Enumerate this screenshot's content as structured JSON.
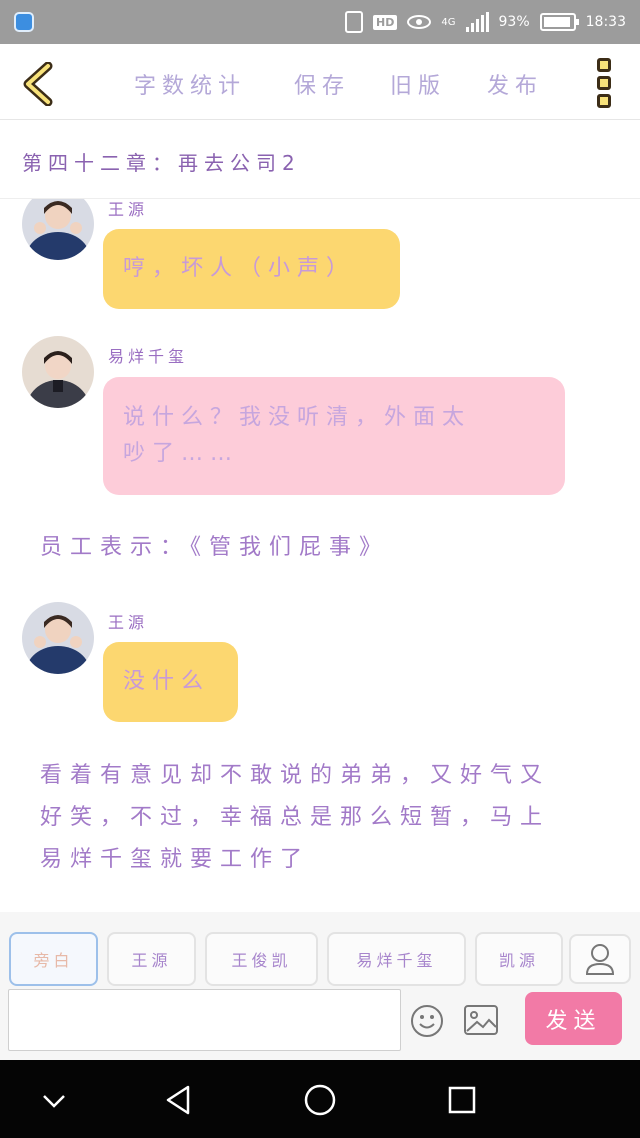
{
  "status_bar": {
    "network": "4G",
    "hd_badge": "HD",
    "battery": "93%",
    "time": "18:33"
  },
  "toolbar": {
    "word_count": "字数统计",
    "save": "保存",
    "old_version": "旧版",
    "publish": "发布"
  },
  "chapter": {
    "title": "第四十二章：再去公司2"
  },
  "messages": [
    {
      "speaker": "王源",
      "text": "哼，坏人（小声）"
    },
    {
      "speaker": "易烊千玺",
      "text_line1": "说什么？我没听清，外面太",
      "text_line2": "吵了……"
    },
    {
      "narration": "员工表示：《管我们屁事》"
    },
    {
      "speaker": "王源",
      "text": "没什么"
    },
    {
      "narration_line1": "看着有意见却不敢说的弟弟，又好气又",
      "narration_line2": "好笑，不过，幸福总是那么短暂，马上",
      "narration_line3": "易烊千玺就要工作了"
    }
  ],
  "roles": {
    "narrator": "旁白",
    "wang_yuan": "王源",
    "wang_junkai": "王俊凯",
    "yiyang_qianxi": "易烊千玺",
    "kai_yuan": "凯源"
  },
  "input": {
    "placeholder": "",
    "send": "发送"
  },
  "colors": {
    "yellow_bubble": "#fcd770",
    "pink_bubble": "#fdccd9",
    "send_button": "#f27aa6",
    "text_purple": "#9a6ec2"
  }
}
